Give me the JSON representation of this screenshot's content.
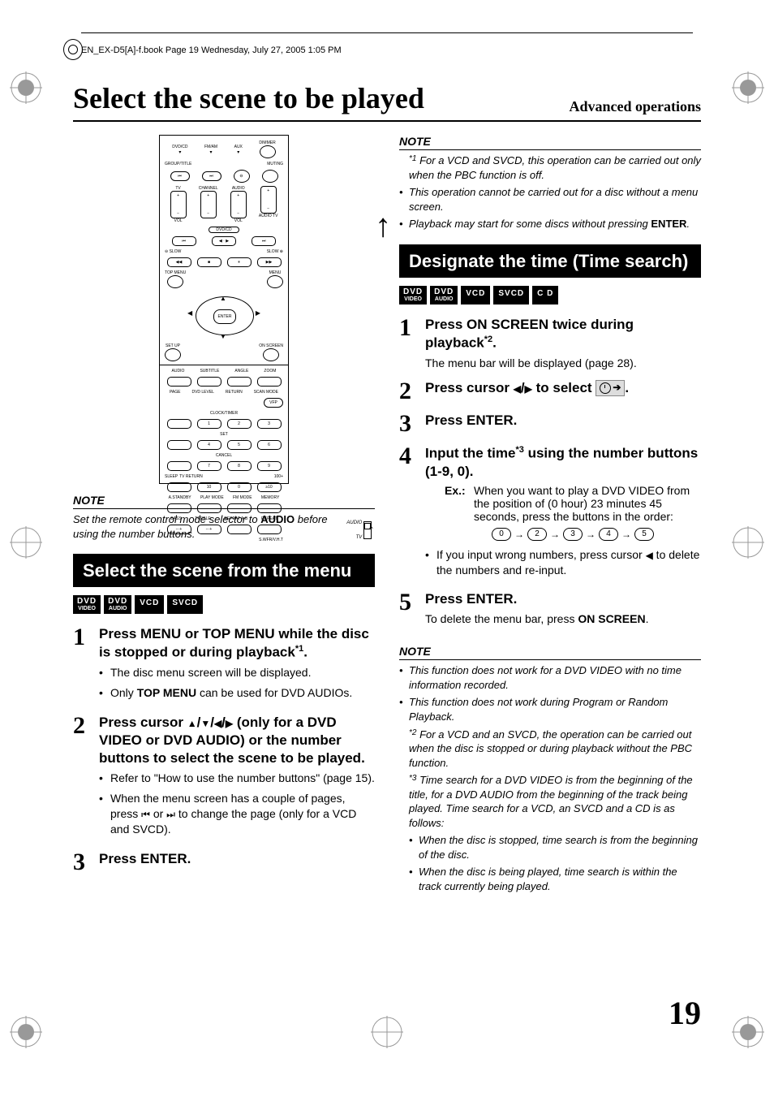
{
  "header": {
    "running_head": "EN_EX-D5[A]-f.book  Page 19  Wednesday, July 27, 2005  1:05 PM"
  },
  "title": "Select the scene to be played",
  "section_label": "Advanced operations",
  "page_number": "19",
  "remote": {
    "rows": {
      "r1": [
        "DVD/CD",
        "FM/AM",
        "AUX",
        "DIMMER"
      ],
      "r2_label_left": "GROUP/TITLE",
      "r2_label_right": "MUTING",
      "r3_left": "TV",
      "r3_mid": "CHANNEL",
      "r3_right": "AUDIO",
      "r3_vol": "VOL",
      "r3_audio_tv": "AUDIO TV",
      "dvdcd_bar": "DVD/CD",
      "transport": [
        "⏮",
        "◀",
        "▶",
        "⏭"
      ],
      "slow_l": "⊖ SLOW",
      "slow_r": "SLOW ⊕",
      "transport2": [
        "◀◀",
        "■",
        "⏸",
        "▶▶"
      ],
      "nav_top": "TOP MENU",
      "nav_menu": "MENU",
      "nav_enter": "ENTER",
      "nav_setup": "SET UP",
      "nav_onscreen": "ON SCREEN",
      "grid_r1": [
        "AUDIO",
        "SUBTITLE",
        "ANGLE",
        "ZOOM"
      ],
      "grid_r1b": [
        "PAGE",
        "DVD LEVEL",
        "RETURN",
        "SCAN MODE"
      ],
      "grid_vfp": "VFP",
      "clocktimer": "CLOCK/TIMER",
      "nums_r1": [
        "1",
        "2",
        "3"
      ],
      "set": "SET",
      "nums_r2": [
        "4",
        "5",
        "6"
      ],
      "cancel": "CANCEL",
      "nums_r3": [
        "7",
        "8",
        "9"
      ],
      "sleep": "SLEEP",
      "tvreturn": "TV RETURN",
      "nums_r4": [
        "10",
        "0",
        "≥10"
      ],
      "hund": "100+",
      "bottom_r1": [
        "A.STANDBY",
        "PLAY MODE",
        "FM MODE",
        "MEMORY"
      ],
      "bottom_r2": [
        "BASS",
        "TREBLE",
        "REPEAT A-B",
        "REPEAT"
      ],
      "swfr": "S.WFR/V.H.T"
    }
  },
  "col_left": {
    "note1": {
      "heading": "NOTE",
      "line1": "Set the remote control mode selector to ",
      "strong": "AUDIO",
      "line2": " before using the number buttons.",
      "selector_top": "AUDIO",
      "selector_bottom": "TV"
    },
    "heading": "Select the scene from the menu",
    "badges": [
      "DVD VIDEO",
      "DVD AUDIO",
      "VCD",
      "SVCD"
    ],
    "steps": [
      {
        "num": "1",
        "title_a": "Press MENU or TOP MENU while the disc is stopped or during playback",
        "title_sup": "*1",
        "title_b": ".",
        "bullets": [
          "The disc menu screen will be displayed.",
          {
            "pre": "Only ",
            "strong": "TOP MENU",
            "post": " can be used for DVD AUDIOs."
          }
        ]
      },
      {
        "num": "2",
        "title_a": "Press cursor ",
        "cursor_set": "udlr",
        "title_b": " (only for a DVD VIDEO or DVD AUDIO) or the number buttons to select the scene to be played.",
        "bullets": [
          "Refer to \"How to use the number buttons\" (page 15).",
          {
            "pre": "When the menu screen has a couple of pages, press ",
            "iconset": "prevnext",
            "post": " to change the page (only for a VCD and SVCD)."
          }
        ]
      },
      {
        "num": "3",
        "title_a": "Press ENTER."
      }
    ]
  },
  "col_right": {
    "note1": {
      "heading": "NOTE",
      "items": [
        {
          "sup": "*1",
          "text": "For a VCD and SVCD, this operation can be carried out only when the PBC function is off."
        },
        {
          "text": "This operation cannot be carried out for a disc without a menu screen."
        },
        {
          "pre": "Playback may start for some discs without pressing ",
          "strong": "ENTER",
          "post": "."
        }
      ]
    },
    "heading": "Designate the time (Time search)",
    "badges": [
      "DVD VIDEO",
      "DVD AUDIO",
      "VCD",
      "SVCD",
      "C D"
    ],
    "steps": [
      {
        "num": "1",
        "title_a": "Press ON SCREEN twice during playback",
        "title_sup": "*2",
        "title_b": ".",
        "desc": "The menu bar will be displayed (page 28)."
      },
      {
        "num": "2",
        "title_a": "Press cursor ",
        "cursor_set": "lr",
        "title_b": " to select ",
        "time_icon": true,
        "title_c": "."
      },
      {
        "num": "3",
        "title_a": "Press ENTER."
      },
      {
        "num": "4",
        "title_a": "Input the time",
        "title_sup": "*3",
        "title_b": " using the number buttons (1-9, 0).",
        "ex_label": "Ex.:",
        "ex_text": "When you want to play a DVD VIDEO from the position of (0 hour) 23 minutes 45 seconds, press the buttons in the order:",
        "num_seq": [
          "0",
          "2",
          "3",
          "4",
          "5"
        ],
        "bullets": [
          {
            "pre": "If you input wrong numbers, press cursor ",
            "icon": "left",
            "post": " to delete the numbers and re-input."
          }
        ]
      },
      {
        "num": "5",
        "title_a": "Press ENTER.",
        "desc_pre": "To delete the menu bar, press ",
        "desc_strong": "ON SCREEN",
        "desc_post": "."
      }
    ],
    "note2": {
      "heading": "NOTE",
      "items": [
        {
          "text": "This function does not work for a DVD VIDEO with no time information recorded."
        },
        {
          "text": "This function does not work during Program or Random Playback."
        },
        {
          "sup": "*2",
          "text": "For a VCD and an SVCD, the operation can be carried out when the disc is stopped or during playback without the PBC function."
        },
        {
          "sup": "*3",
          "text": "Time search for a DVD VIDEO is from the beginning of the title, for a DVD AUDIO from the beginning of the track being played. Time search for a VCD, an SVCD and a CD is as follows:"
        },
        {
          "sub": true,
          "text": "When the disc is stopped, time search is from the beginning of the disc."
        },
        {
          "sub": true,
          "text": "When the disc is being played, time search is within the track currently being played."
        }
      ]
    }
  }
}
